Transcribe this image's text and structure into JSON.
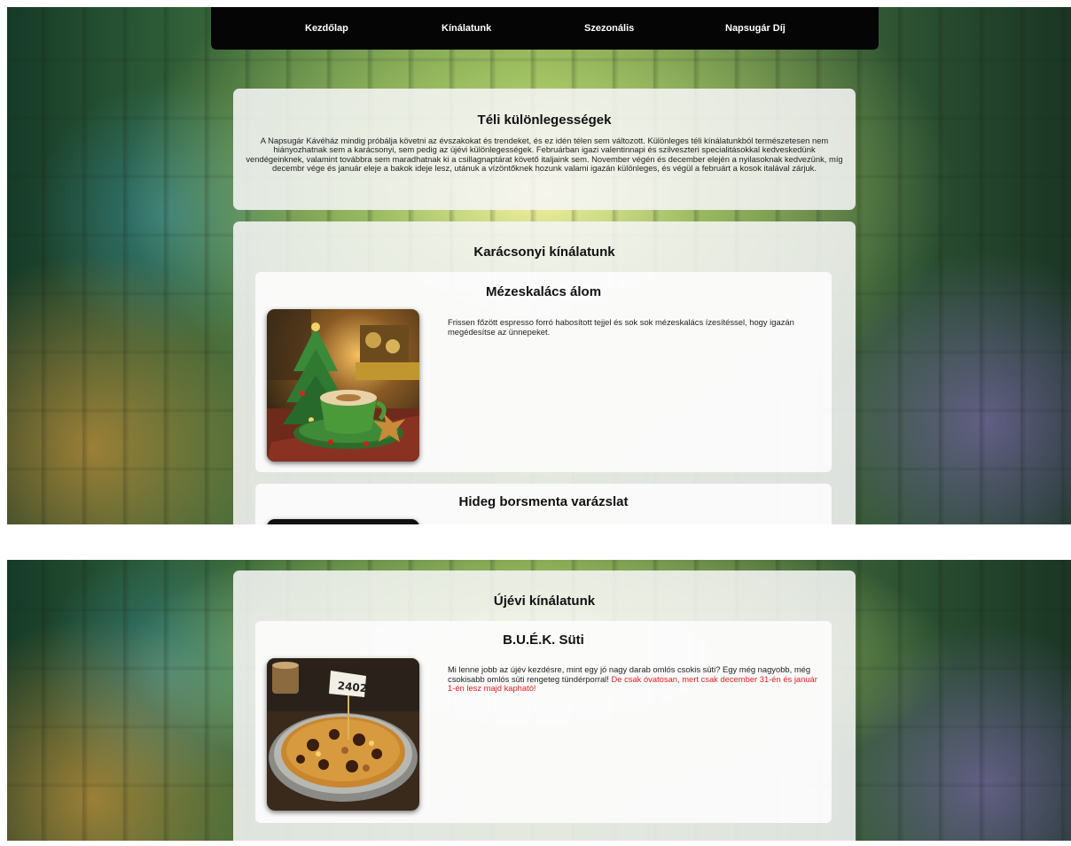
{
  "nav": {
    "items": [
      {
        "label": "Kezdőlap"
      },
      {
        "label": "Kínálatunk"
      },
      {
        "label": "Szezonális"
      },
      {
        "label": "Napsugár Díj"
      }
    ]
  },
  "intro": {
    "title": "Téli különlegességek",
    "text": "A Napsugár Kávéház mindig próbálja követni az évszakokat és trendeket, és ez idén télen sem változott. Különleges téli kínálatunkból természetesen nem hiányozhatnak sem a karácsonyi, sem pedig az újévi különlegességek. Februárban igazi valentinnapi és szilveszteri specialitásokkal kedveskedünk vendégeinknek, valamint továbbra sem maradhatnak ki a csillagnaptárat követő italjaink sem. November végén és december elején a nyilasoknak kedvezünk, míg decembr vége és január eleje a bakok ideje lesz, utánuk a vízöntőknek hozunk valami igazán különleges, és végül a februárt a kosok italával zárjuk."
  },
  "christmas": {
    "title": "Karácsonyi kínálatunk",
    "items": [
      {
        "name": "Mézeskalács álom",
        "description": "Frissen főzött espresso forró habosított tejjel és sok sok mézeskalács ízesítéssel, hogy igazán megédesítse az ünnepeket."
      },
      {
        "name": "Hideg borsmenta varázslat"
      }
    ]
  },
  "newyear": {
    "title": "Újévi kínálatunk",
    "items": [
      {
        "name": "B.U.É.K. Süti",
        "description": "Mi lenne jobb az újév kezdésre, mint egy jó nagy darab omlós csokis süti? Egy még nagyobb, még csokisabb omlós süti rengeteg tündérporral!",
        "description_highlight": " De csak óvatosan, mert csak december 31-én és január 1-én lesz majd kapható!",
        "flag_text": "2402"
      }
    ]
  },
  "colors": {
    "nav_bg": "#050505",
    "highlight": "#e02020"
  }
}
